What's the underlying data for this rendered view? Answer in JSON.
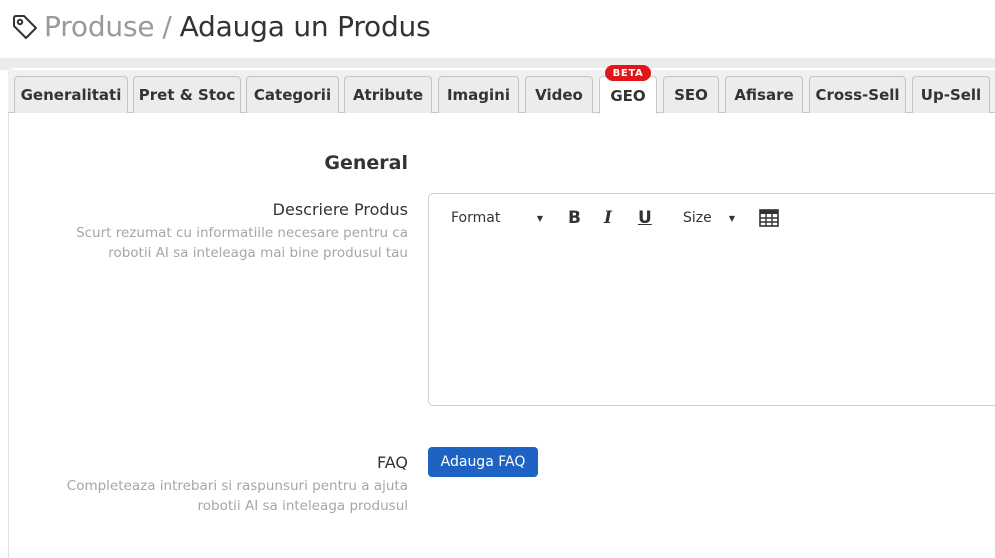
{
  "header": {
    "icon": "tag-icon",
    "breadcrumb": "Produse",
    "separator": "/",
    "title": "Adauga un Produs"
  },
  "tabs": [
    {
      "label": "Generalitati"
    },
    {
      "label": "Pret & Stoc"
    },
    {
      "label": "Categorii"
    },
    {
      "label": "Atribute"
    },
    {
      "label": "Imagini"
    },
    {
      "label": "Video"
    },
    {
      "label": "GEO",
      "badge": "BETA",
      "active": true
    },
    {
      "label": "SEO"
    },
    {
      "label": "Afisare"
    },
    {
      "label": "Cross-Sell"
    },
    {
      "label": "Up-Sell"
    }
  ],
  "section": {
    "title": "General"
  },
  "description_field": {
    "label": "Descriere Produs",
    "help": "Scurt rezumat cu informatiile necesare pentru ca robotii AI sa inteleaga mai bine produsul tau"
  },
  "editor": {
    "format_label": "Format",
    "bold": "B",
    "italic": "I",
    "underline": "U",
    "size_label": "Size",
    "table_icon": "table-icon",
    "content": ""
  },
  "faq_field": {
    "label": "FAQ",
    "help": "Completeaza intrebari si raspunsuri pentru a ajuta robotii AI sa inteleaga produsul",
    "button_label": "Adauga FAQ"
  },
  "colors": {
    "primary_button": "#1e63c4",
    "beta_badge": "#e0161b",
    "help_text": "#a6a6a6"
  }
}
